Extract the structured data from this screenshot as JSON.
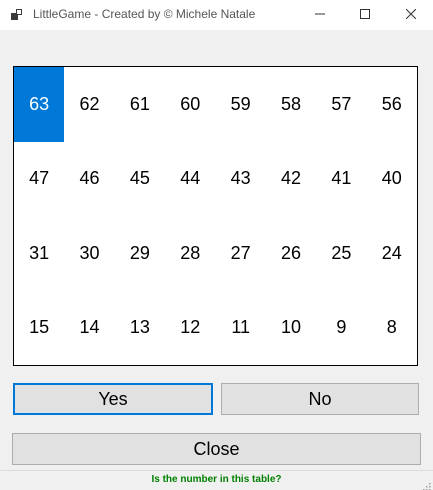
{
  "window": {
    "title": "LittleGame - Created by © Michele Natale",
    "icon": "app-window-icon",
    "controls": [
      "minimize-icon",
      "maximize-icon",
      "close-icon"
    ]
  },
  "grid": {
    "selected_value": "63",
    "cells": [
      "63",
      "62",
      "61",
      "60",
      "59",
      "58",
      "57",
      "56",
      "47",
      "46",
      "45",
      "44",
      "43",
      "42",
      "41",
      "40",
      "31",
      "30",
      "29",
      "28",
      "27",
      "26",
      "25",
      "24",
      "15",
      "14",
      "13",
      "12",
      "11",
      "10",
      "9",
      "8"
    ]
  },
  "buttons": {
    "yes_label": "Yes",
    "no_label": "No",
    "close_label": "Close"
  },
  "status": {
    "text": "Is the number in this table?",
    "color": "#008000"
  },
  "colors": {
    "selection": "#0078d7",
    "focus_border": "#0078d7"
  }
}
